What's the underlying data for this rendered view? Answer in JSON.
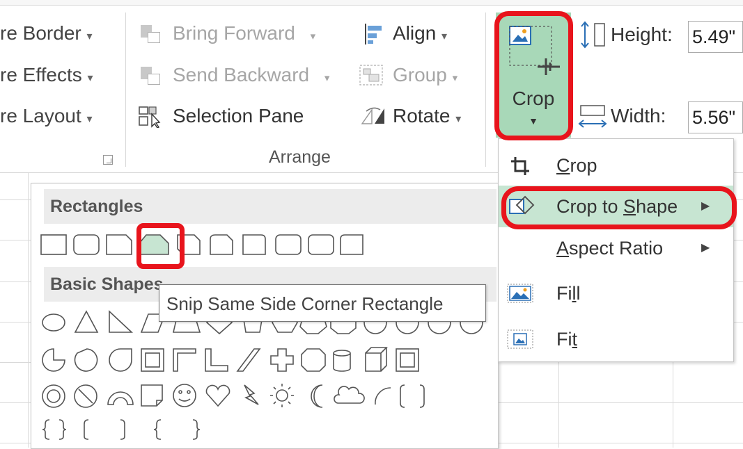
{
  "ribbon": {
    "picture_styles": [
      {
        "label": "re Border",
        "arrow": "▾"
      },
      {
        "label": "re Effects",
        "arrow": "▾"
      },
      {
        "label": "re Layout",
        "arrow": "▾"
      }
    ],
    "arrange": {
      "bring_forward": "Bring Forward",
      "send_backward": "Send Backward",
      "selection_pane": "Selection Pane",
      "align": "Align",
      "group": "Group",
      "rotate": "Rotate",
      "group_label": "Arrange"
    },
    "size": {
      "crop_label": "Crop",
      "height_label": "Height:",
      "height_value": "5.49\"",
      "width_label": "Width:",
      "width_value": "5.56\""
    },
    "colors": {
      "accent_green": "#a8d8b8",
      "highlight_red": "#e8141c"
    }
  },
  "crop_menu": {
    "items": [
      {
        "label": "Crop",
        "mnemonic": "C",
        "icon": "crop-icon"
      },
      {
        "label": "Crop to Shape",
        "mnemonic": "S",
        "icon": "crop-to-shape-icon",
        "submenu": true,
        "highlighted": true
      },
      {
        "label": "Aspect Ratio",
        "mnemonic": "A",
        "submenu": true
      },
      {
        "label": "Fill",
        "mnemonic": "l",
        "icon": "fill-icon"
      },
      {
        "label": "Fit",
        "mnemonic": "t",
        "icon": "fit-icon"
      }
    ],
    "labels": {
      "crop_pre": "",
      "crop_u": "C",
      "crop_post": "rop",
      "shape_pre": "Crop to ",
      "shape_u": "S",
      "shape_post": "hape",
      "aspect_pre": "",
      "aspect_u": "A",
      "aspect_post": "spect Ratio",
      "fill_pre": "Fi",
      "fill_u": "l",
      "fill_post": "l",
      "fit_pre": "Fi",
      "fit_u": "t",
      "fit_post": ""
    }
  },
  "shape_gallery": {
    "sections": [
      {
        "title": "Rectangles"
      },
      {
        "title": "Basic Shapes"
      }
    ],
    "selected_shape": "Snip Same Side Corner Rectangle"
  },
  "tooltip": {
    "text": "Snip Same Side Corner Rectangle"
  }
}
